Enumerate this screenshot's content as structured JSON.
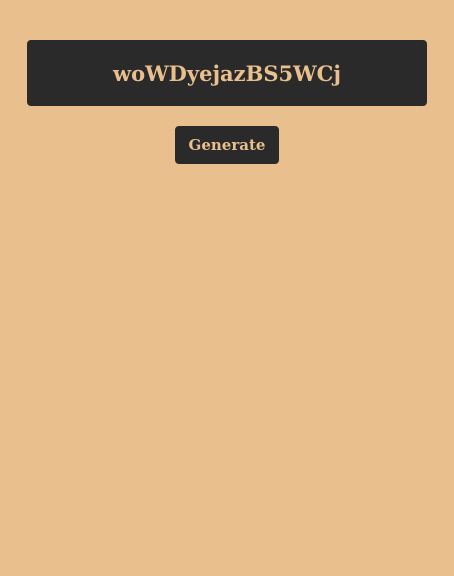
{
  "output": {
    "value": "woWDyejazBS5WCj"
  },
  "controls": {
    "generate_label": "Generate"
  },
  "colors": {
    "background": "#e9c08d",
    "panel": "#2a2a2a",
    "accent_text": "#e9c08d"
  }
}
